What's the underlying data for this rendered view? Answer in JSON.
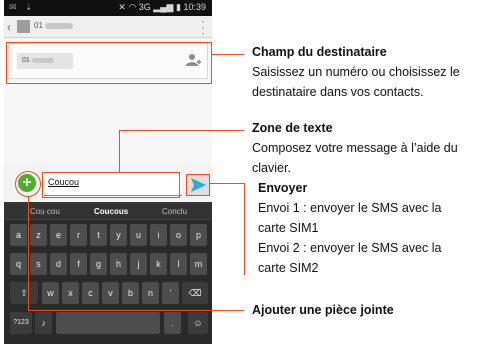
{
  "status": {
    "time": "10:39",
    "network": "3G"
  },
  "header": {
    "number_prefix": "01"
  },
  "recipient_chip": {
    "prefix": "01"
  },
  "compose": {
    "text": "Coucou"
  },
  "keyboard": {
    "suggestions": [
      "Cou cou",
      "Coucous",
      "Conclu"
    ],
    "row1": [
      "a",
      "z",
      "e",
      "r",
      "t",
      "y",
      "u",
      "i",
      "o",
      "p"
    ],
    "row2": [
      "q",
      "s",
      "d",
      "f",
      "g",
      "h",
      "j",
      "k",
      "l",
      "m"
    ],
    "row3": [
      "w",
      "x",
      "c",
      "v",
      "b",
      "n",
      "'"
    ],
    "bottom_left": "?123",
    "period": "."
  },
  "annotations": {
    "recipient": {
      "title": "Champ du destinataire",
      "line1": "Saisissez un numéro ou choisissez le",
      "line2": "destinataire dans vos contacts."
    },
    "text_area": {
      "title": "Zone de texte",
      "line1": "Composez votre message à l’aide du",
      "line2": "clavier."
    },
    "send": {
      "title": "Envoyer",
      "line1": "Envoi 1 : envoyer le SMS avec la",
      "line2": "carte SIM1",
      "line3": "Envoi 2 : envoyer le SMS avec la",
      "line4": "carte SIM2"
    },
    "attachment": {
      "title": "Ajouter une pièce jointe"
    }
  },
  "colors": {
    "annotation": "#f04d23",
    "attach_button": "#4caf2a",
    "send_arrow": "#2ea7d8"
  }
}
